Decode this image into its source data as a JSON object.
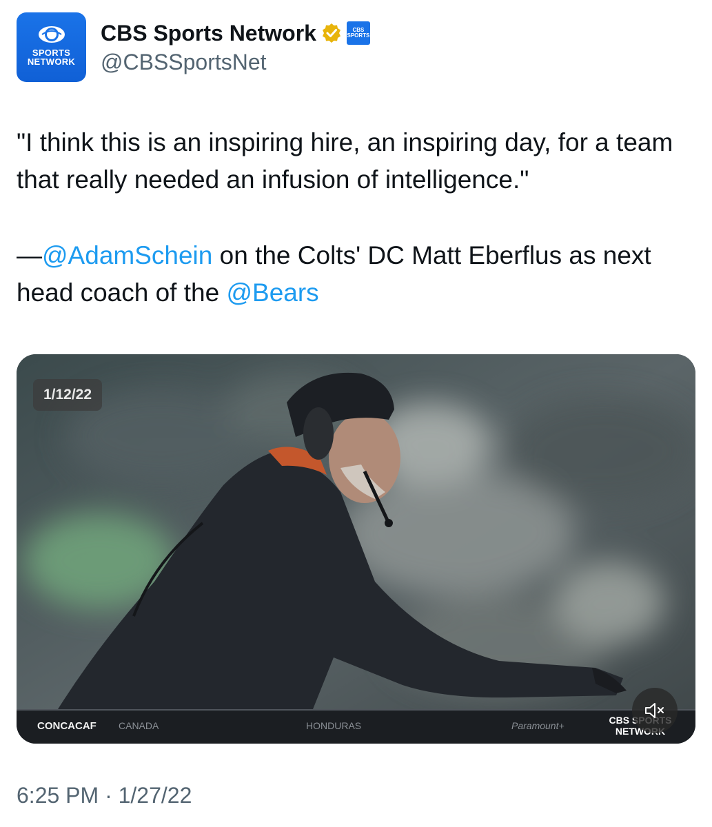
{
  "account": {
    "avatar_line1": "SPORTS",
    "avatar_line2": "NETWORK",
    "display_name": "CBS Sports Network",
    "handle": "@CBSSportsNet",
    "affiliate_line1": "CBS",
    "affiliate_line2": "SPORTS",
    "verified_color": "#e8b40b",
    "brand_color": "#1a73e8"
  },
  "tweet": {
    "quote": "\"I think this is an inspiring hire, an inspiring day, for a team that really needed an infusion of intelligence.\"",
    "attribution_prefix": "—",
    "mention1": "@AdamSchein",
    "attribution_middle": " on the Colts' DC Matt Eberflus as next head coach of the ",
    "mention2": "@Bears",
    "mention_color": "#1d9bf0",
    "timestamp": "6:25 PM · 1/27/22"
  },
  "media": {
    "date_badge": "1/12/22",
    "ticker_left": "CONCACAF",
    "ticker_team1": "CANADA",
    "ticker_team2": "HONDURAS",
    "ticker_sponsor": "Paramount+",
    "network_line1": "CBS SPORTS",
    "network_line2": "NETWORK",
    "mute_icon": "speaker-muted-icon"
  }
}
